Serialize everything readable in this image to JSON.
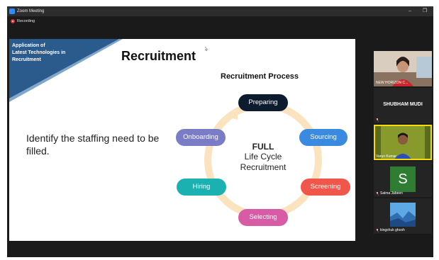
{
  "window": {
    "title": "Zoom Meeting",
    "minimize_glyph": "–",
    "maximize_glyph": "❐"
  },
  "recording": {
    "label": "Recording"
  },
  "slide": {
    "banner_lines": [
      "Application of",
      "Latest Technologies in",
      "Recruitment"
    ],
    "title": "Recruitment",
    "process_title": "Recruitment Process",
    "body_text": "Identify the staffing need to be filled.",
    "steps": [
      "Preparing",
      "Sourcing",
      "Screening",
      "Selecting",
      "Hiring",
      "Onboarding"
    ],
    "center": {
      "line1": "FULL",
      "line2": "Life Cycle",
      "line3": "Recruitment"
    }
  },
  "participants": [
    {
      "name": "NEW HORIZON C...",
      "video": true
    },
    {
      "name": "SHUBHAM MUDI",
      "video": false
    },
    {
      "name": "Varun Kumar",
      "video": true,
      "active": true
    },
    {
      "name": "Salma Jabeen",
      "initial": "S",
      "video": false
    },
    {
      "name": "kingshuk ghosh",
      "video": false
    }
  ],
  "colors": {
    "banner": "#2b5a8c",
    "preparing": "#0d1b2e",
    "sourcing": "#3a8be0",
    "screening": "#f0564a",
    "selecting": "#d75ca5",
    "hiring": "#1bb1b1",
    "onboarding": "#7a7cc6",
    "cycle_ring": "#fbe3bf",
    "active_speaker": "#f5d90a"
  }
}
